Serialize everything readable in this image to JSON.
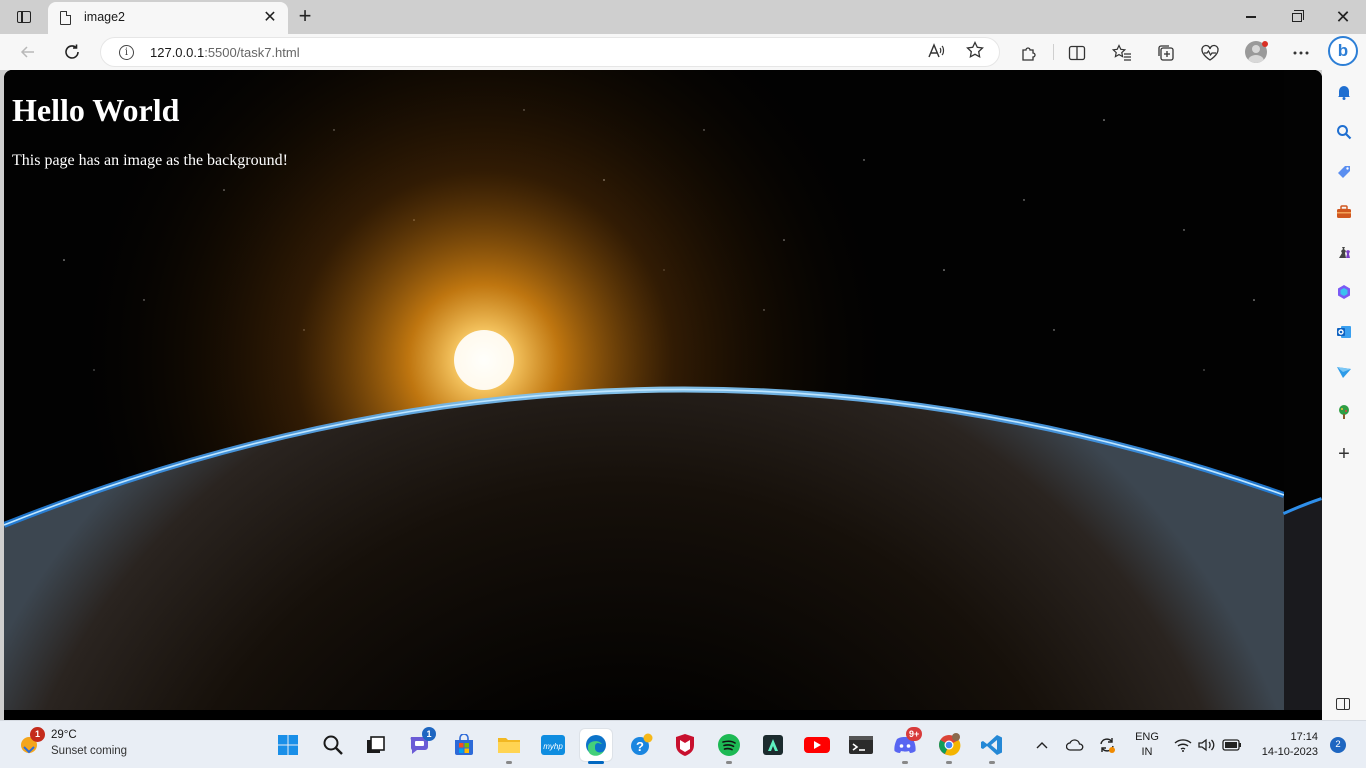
{
  "browser": {
    "tab": {
      "title": "image2",
      "close": "✕"
    },
    "new_tab": "+",
    "window_controls": {
      "close": "✕"
    },
    "address": {
      "host": "127.0.0.1",
      "path": ":5500/task7.html"
    },
    "read_aloud": "A⁄"
  },
  "page": {
    "heading": "Hello World",
    "paragraph": "This page has an image as the background!"
  },
  "sidebar": {
    "items": [
      "bell-icon",
      "search-icon",
      "shopping-tag-icon",
      "toolbox-icon",
      "games-icon",
      "office-icon",
      "outlook-icon",
      "send-icon",
      "tree-icon"
    ],
    "add": "+"
  },
  "taskbar": {
    "weather": {
      "temp": "29°C",
      "desc": "Sunset coming",
      "badge": "1"
    },
    "teams_badge": "1",
    "discord_badge": "9+",
    "tray": {
      "lang_top": "ENG",
      "lang_bottom": "IN"
    },
    "clock": {
      "time": "17:14",
      "date": "14-10-2023"
    },
    "notifications": "2"
  }
}
